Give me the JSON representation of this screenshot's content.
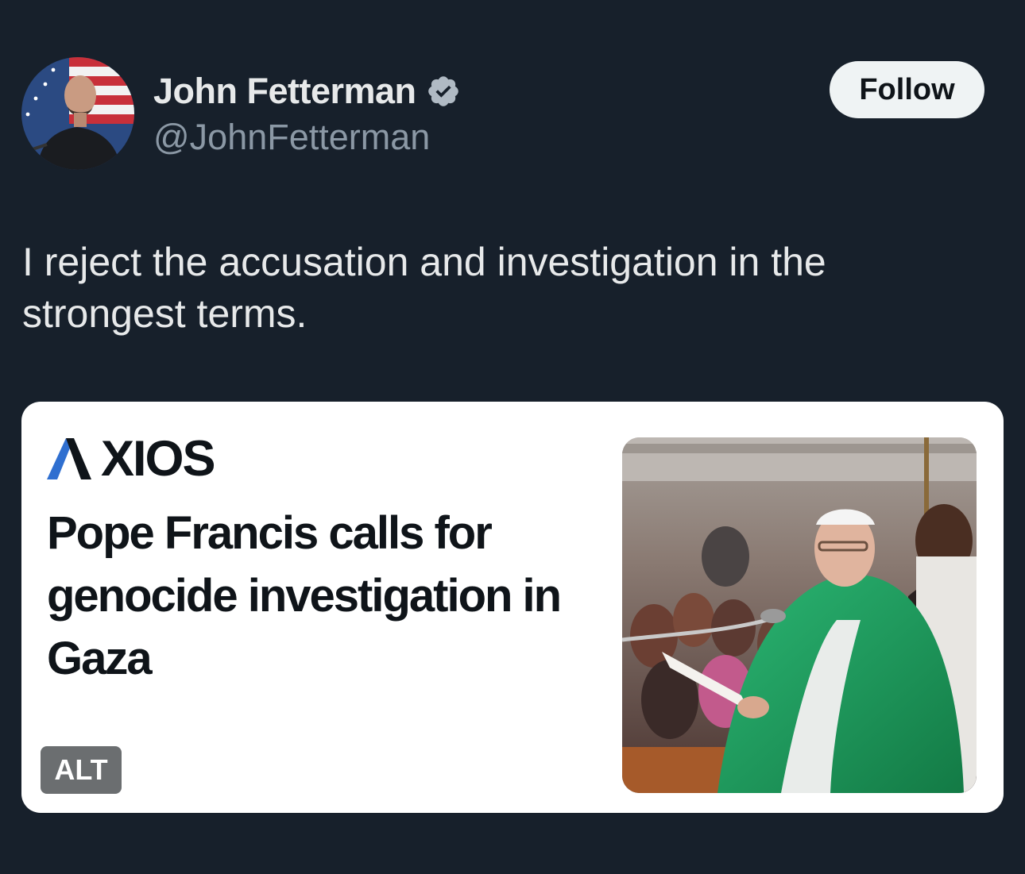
{
  "author": {
    "display_name": "John Fetterman",
    "handle": "@JohnFetterman",
    "verified": true
  },
  "follow_button": {
    "label": "Follow"
  },
  "tweet": {
    "text": "I reject the accusation and investigation in the strongest terms."
  },
  "media": {
    "source_logo": "AXIOS",
    "headline": "Pope Francis calls for genocide investigation in Gaza",
    "alt_badge": "ALT"
  },
  "colors": {
    "background": "#17202b",
    "text_primary": "#e7e9ea",
    "text_secondary": "#8b98a5",
    "verified_badge": "#b0bac4",
    "follow_button_bg": "#eff3f4",
    "axios_blue": "#2f6fd0",
    "vestment_green": "#1f9a5e"
  },
  "icons": {
    "verified": "verified-badge-icon"
  }
}
